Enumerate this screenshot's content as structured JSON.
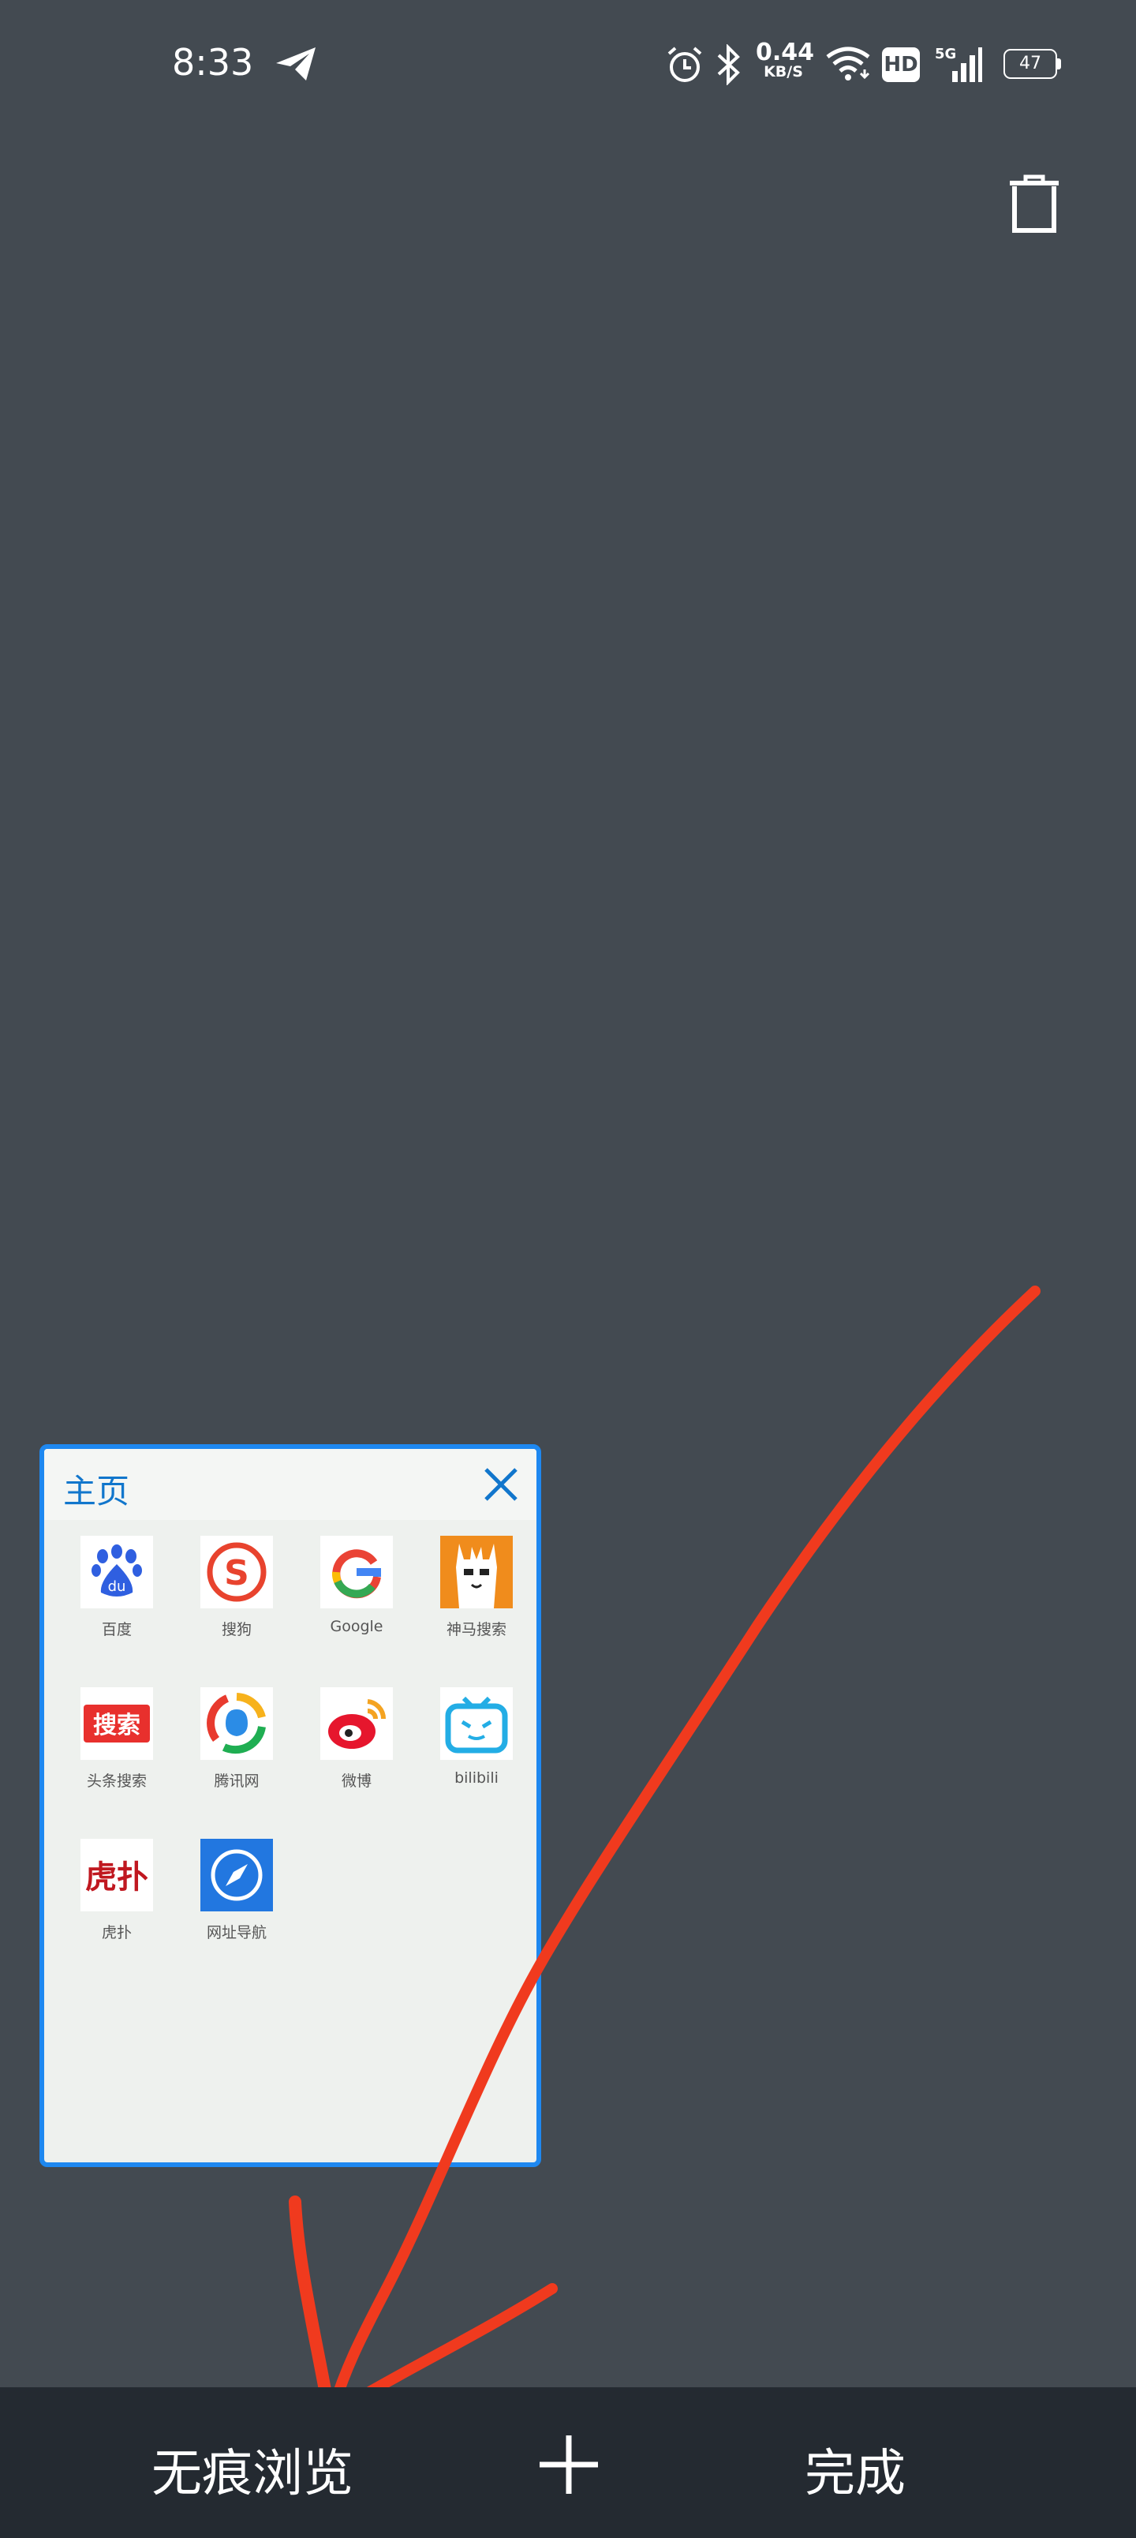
{
  "status_bar": {
    "time": "8:33",
    "net_speed_value": "0.44",
    "net_speed_unit": "KB/S",
    "hd_badge": "HD",
    "network_type": "5G",
    "battery_level": "47",
    "icons": [
      "send-icon",
      "alarm-icon",
      "bluetooth-icon",
      "wifi-icon",
      "hd-icon",
      "signal-icon",
      "battery-icon"
    ]
  },
  "header": {
    "trash_icon": "trash-icon"
  },
  "tab_card": {
    "title": "主页",
    "close_icon": "close-icon",
    "apps": [
      {
        "label": "百度",
        "icon": "baidu-icon"
      },
      {
        "label": "搜狗",
        "icon": "sogou-icon"
      },
      {
        "label": "Google",
        "icon": "google-icon"
      },
      {
        "label": "神马搜索",
        "icon": "shenma-icon"
      },
      {
        "label": "头条搜索",
        "icon": "toutiao-search-icon",
        "badge_text": "搜索"
      },
      {
        "label": "腾讯网",
        "icon": "tencent-icon"
      },
      {
        "label": "微博",
        "icon": "weibo-icon"
      },
      {
        "label": "bilibili",
        "icon": "bilibili-icon"
      },
      {
        "label": "虎扑",
        "icon": "hupu-icon",
        "badge_text": "虎扑"
      },
      {
        "label": "网址导航",
        "icon": "compass-icon"
      }
    ]
  },
  "bottom_bar": {
    "incognito_label": "无痕浏览",
    "new_tab_icon": "plus-icon",
    "done_label": "完成"
  },
  "colors": {
    "background": "#434a51",
    "bottom_bar": "#242a31",
    "card_border": "#1e88f0",
    "annotation_arrow": "#f03a1e"
  }
}
